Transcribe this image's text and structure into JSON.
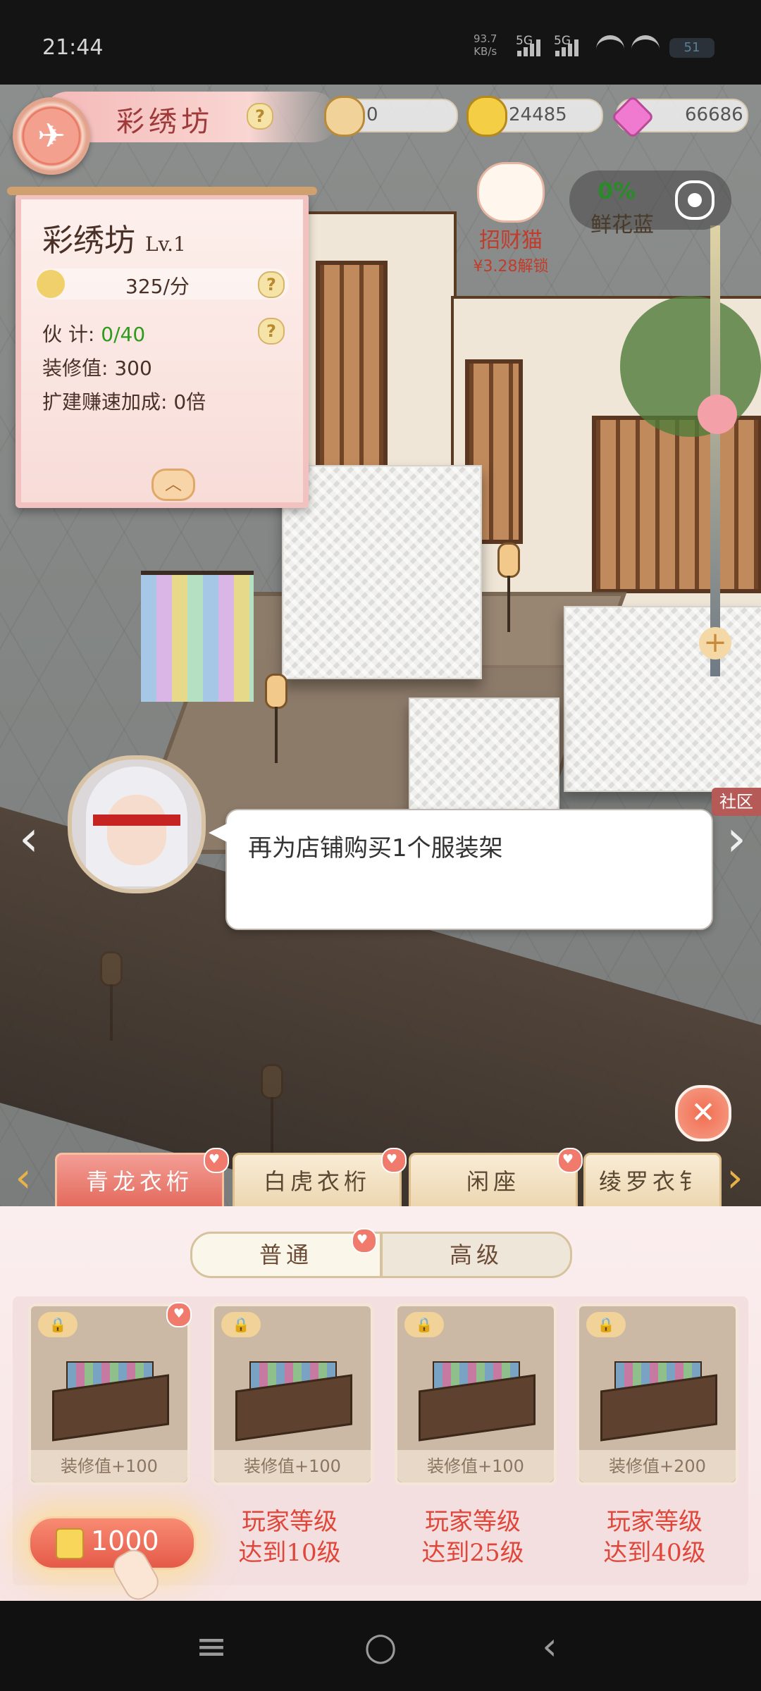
{
  "status_bar": {
    "time": "21:44",
    "net_speed_value": "93.7",
    "net_speed_unit": "KB/s",
    "sim1": "5G",
    "sim2": "5G",
    "battery": "51"
  },
  "header": {
    "title": "彩绣坊",
    "back_icon": "back-arrow-icon",
    "resources": [
      {
        "icon": "scroll-icon",
        "value": "0"
      },
      {
        "icon": "coin-icon",
        "value": "24485"
      },
      {
        "icon": "diamond-icon",
        "value": "66686"
      }
    ]
  },
  "shop_info": {
    "name": "彩绣坊",
    "level": "Lv.1",
    "income": "325/分",
    "staff_label": "伙    计:",
    "staff_value": "0/40",
    "decoration_label": "装修值:",
    "decoration_value": "300",
    "expand_label": "扩建赚速加成:",
    "expand_value": "0倍"
  },
  "lucky_cat": {
    "name": "招财猫",
    "price": "¥3.28解锁"
  },
  "flower_basket": {
    "progress": "0%",
    "name": "鲜花蓝"
  },
  "community_tab": "社区",
  "dialog": {
    "text": "再为店铺购买1个服装架"
  },
  "category_tabs": [
    {
      "label": "青龙衣桁",
      "active": true
    },
    {
      "label": "白虎衣桁",
      "active": false
    },
    {
      "label": "闲座",
      "active": false
    },
    {
      "label": "绫罗衣钅",
      "active": false
    }
  ],
  "tier_tabs": [
    {
      "label": "普通",
      "active": true
    },
    {
      "label": "高级",
      "active": false
    }
  ],
  "items": [
    {
      "decoration": "装修值+100",
      "price": "1000",
      "req_line1": "",
      "req_line2": ""
    },
    {
      "decoration": "装修值+100",
      "price": "",
      "req_line1": "玩家等级",
      "req_line2": "达到10级"
    },
    {
      "decoration": "装修值+100",
      "price": "",
      "req_line1": "玩家等级",
      "req_line2": "达到25级"
    },
    {
      "decoration": "装修值+200",
      "price": "",
      "req_line1": "玩家等级",
      "req_line2": "达到40级"
    }
  ],
  "colors": {
    "accent": "#e36a5c",
    "requirement_text": "#e0473a",
    "staff_value": "#2e9b1c"
  },
  "nav_icons": [
    "menu-icon",
    "home-icon",
    "back-icon"
  ]
}
